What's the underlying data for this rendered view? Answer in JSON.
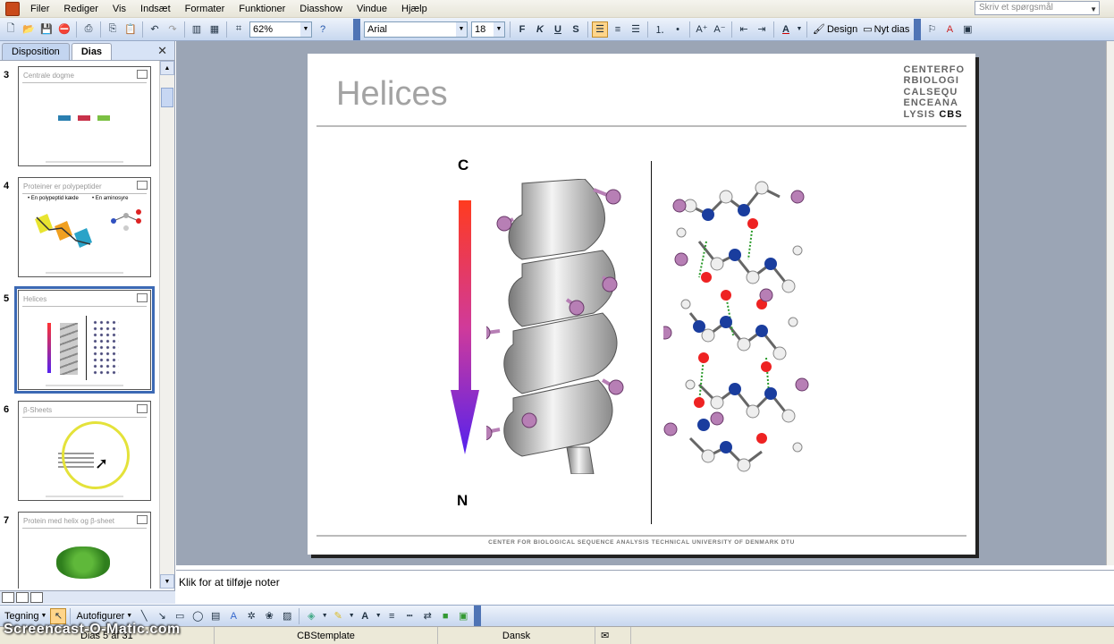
{
  "menubar": {
    "items": [
      "Filer",
      "Rediger",
      "Vis",
      "Indsæt",
      "Formater",
      "Funktioner",
      "Diasshow",
      "Vindue",
      "Hjælp"
    ],
    "help_placeholder": "Skriv et spørgsmål"
  },
  "toolbar": {
    "zoom": "62%",
    "font": "Arial",
    "font_size": "18",
    "design_label": "Design",
    "new_slide_label": "Nyt dias"
  },
  "left_panel": {
    "tabs": [
      "Disposition",
      "Dias"
    ],
    "active_tab": "Dias",
    "slides": [
      {
        "number": "3",
        "title": "Centrale dogme"
      },
      {
        "number": "4",
        "title": "Proteiner er polypeptider",
        "bullet1": "En polypeptid kæde",
        "bullet2": "En aminosyre"
      },
      {
        "number": "5",
        "title": "Helices",
        "selected": true
      },
      {
        "number": "6",
        "title": "β-Sheets"
      },
      {
        "number": "7",
        "title": "Protein med helix og β-sheet"
      }
    ]
  },
  "slide": {
    "title": "Helices",
    "logo_lines": [
      "CENTERFO",
      "RBIOLOGI",
      "CALSEQU",
      "ENCEANA",
      "LYSIS"
    ],
    "logo_bold": "CBS",
    "label_c": "C",
    "label_n": "N",
    "footer": "CENTER FOR BIOLOGICAL SEQUENCE ANALYSIS TECHNICAL UNIVERSITY OF DENMARK DTU"
  },
  "notes": {
    "placeholder": "Klik for at tilføje noter"
  },
  "drawbar": {
    "drawing_label": "Tegning",
    "autoshapes_label": "Autofigurer"
  },
  "status": {
    "slide_info": "Dias 5 af 31",
    "template": "CBStemplate",
    "language": "Dansk"
  },
  "watermark": "Screencast-O-Matic.com",
  "colors": {
    "arrow_top": "#ff3b1f",
    "arrow_bottom": "#5522ee",
    "selection": "#3c69b4"
  }
}
